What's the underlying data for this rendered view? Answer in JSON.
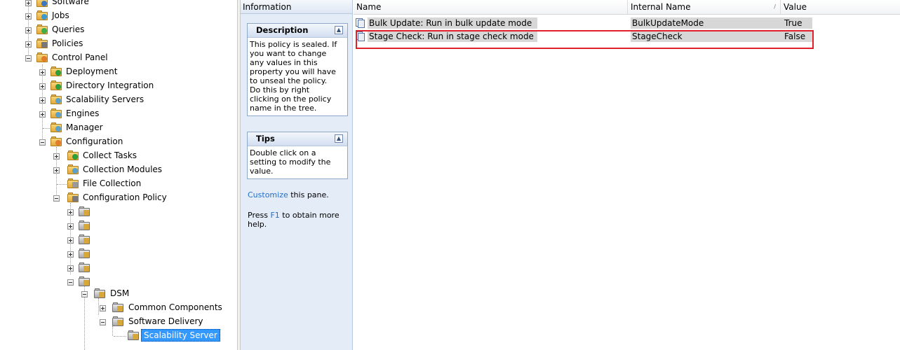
{
  "tree": {
    "items": [
      {
        "label": "Software"
      },
      {
        "label": "Jobs"
      },
      {
        "label": "Queries"
      },
      {
        "label": "Policies"
      },
      {
        "label": "Control Panel"
      },
      {
        "label": "Deployment"
      },
      {
        "label": "Directory Integration"
      },
      {
        "label": "Scalability Servers"
      },
      {
        "label": "Engines"
      },
      {
        "label": "Manager"
      },
      {
        "label": "Configuration"
      },
      {
        "label": "Collect Tasks"
      },
      {
        "label": "Collection Modules"
      },
      {
        "label": "File Collection"
      },
      {
        "label": "Configuration Policy"
      },
      {
        "label": "DSM"
      },
      {
        "label": "Common Components"
      },
      {
        "label": "Software Delivery"
      },
      {
        "label": "Scalability Server"
      }
    ]
  },
  "info": {
    "header": "Information",
    "description": {
      "title": "Description",
      "lines": [
        "This policy is sealed. If",
        "you want to change",
        "any values in this",
        "property you will have",
        "to unseal the policy.",
        "Do this by right",
        "clicking on the policy",
        "name in the tree."
      ]
    },
    "tips": {
      "title": "Tips",
      "lines": [
        "Double click on a",
        "setting to modify the",
        "value."
      ]
    },
    "customize_link": "Customize",
    "customize_rest": " this pane.",
    "press_pre": "Press ",
    "press_key": "F1",
    "press_post": " to obtain more",
    "press_line2": "help."
  },
  "list": {
    "columns": {
      "name": "Name",
      "internal": "Internal Name",
      "value": "Value"
    },
    "rows": [
      {
        "name": "Bulk Update: Run in bulk update mode",
        "internal": "BulkUpdateMode",
        "value": "True"
      },
      {
        "name": "Stage Check: Run in stage check mode",
        "internal": "StageCheck",
        "value": "False"
      }
    ]
  },
  "colors": {
    "highlight": "#e0202a",
    "selection": "#3399ff"
  }
}
